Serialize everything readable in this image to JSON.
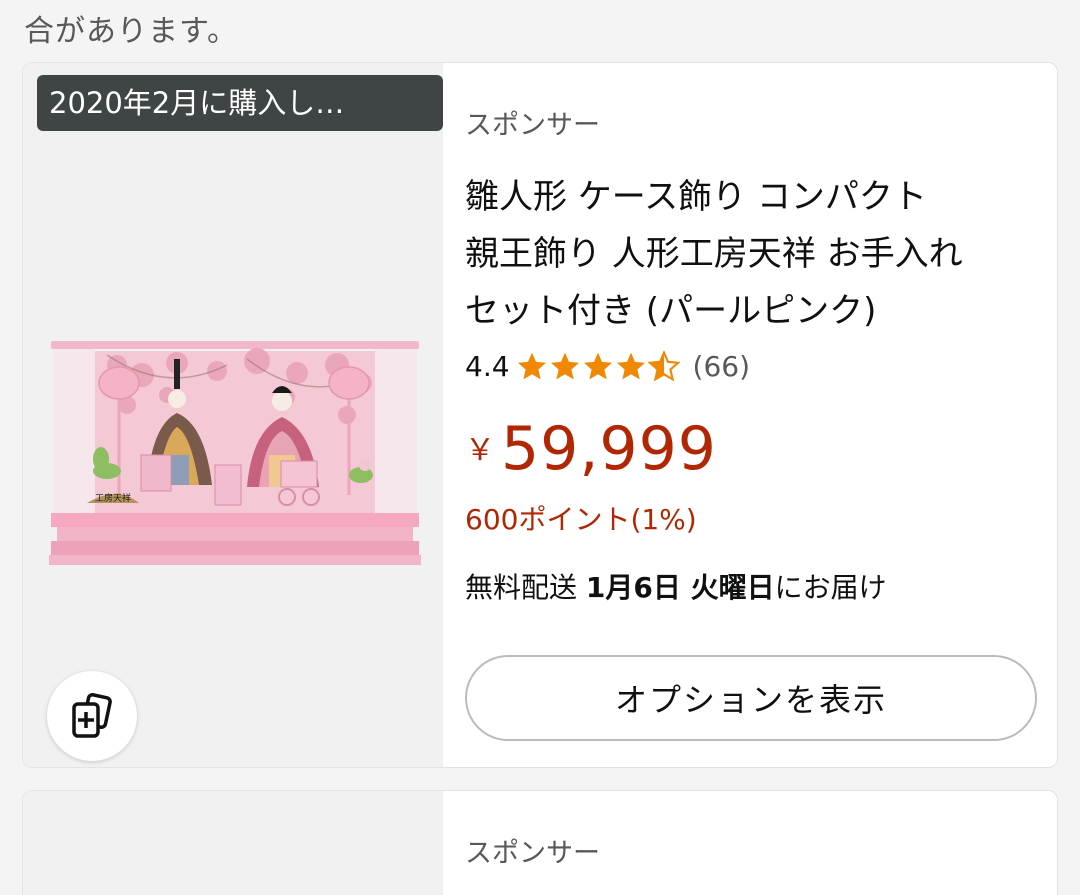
{
  "top_text": "合があります。",
  "product": {
    "purchase_badge": "2020年2月に購入し…",
    "sponsor_label": "スポンサー",
    "title_lines": [
      "雛人形 ケース飾り コンパクト",
      "親王飾り 人形工房天祥 お手入れ",
      "セット付き (パールピンク)"
    ],
    "rating_value": "4.4",
    "rating_stars": 4.4,
    "rating_count": "(66)",
    "price_symbol": "￥",
    "price_value": "59,999",
    "points": "600ポイント(1%)",
    "delivery_prefix": "無料配送 ",
    "delivery_date": "1月6日 火曜日",
    "delivery_suffix": "にお届け",
    "options_button": "オプションを表示",
    "image_plaque_text": "工房天祥",
    "colors": {
      "price": "#b12704",
      "star": "#f08804",
      "badge_bg": "#3f4545"
    }
  },
  "next_card": {
    "sponsor_label": "スポンサー"
  }
}
